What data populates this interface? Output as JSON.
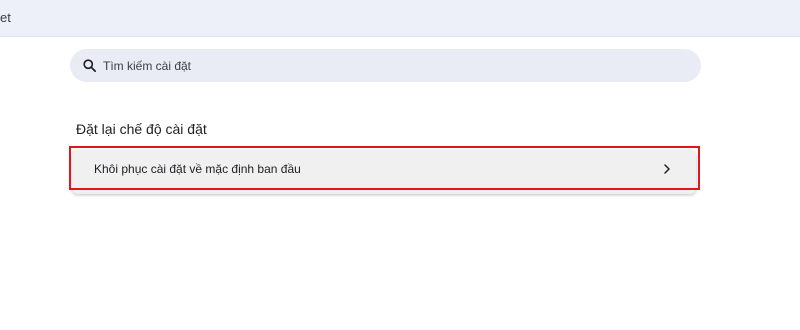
{
  "topbar": {
    "text": "et"
  },
  "search": {
    "placeholder": "Tìm kiếm cài đặt",
    "icon": "search-icon"
  },
  "section": {
    "title": "Đặt lại chế độ cài đặt",
    "items": [
      {
        "label": "Khôi phục cài đặt về mặc định ban đầu",
        "icon": "chevron-right-icon"
      }
    ]
  },
  "colors": {
    "topbar_bg": "#edf0f9",
    "search_bg": "#e9ecf5",
    "card_bg": "#f0f0f0",
    "highlight": "#e4141b"
  }
}
